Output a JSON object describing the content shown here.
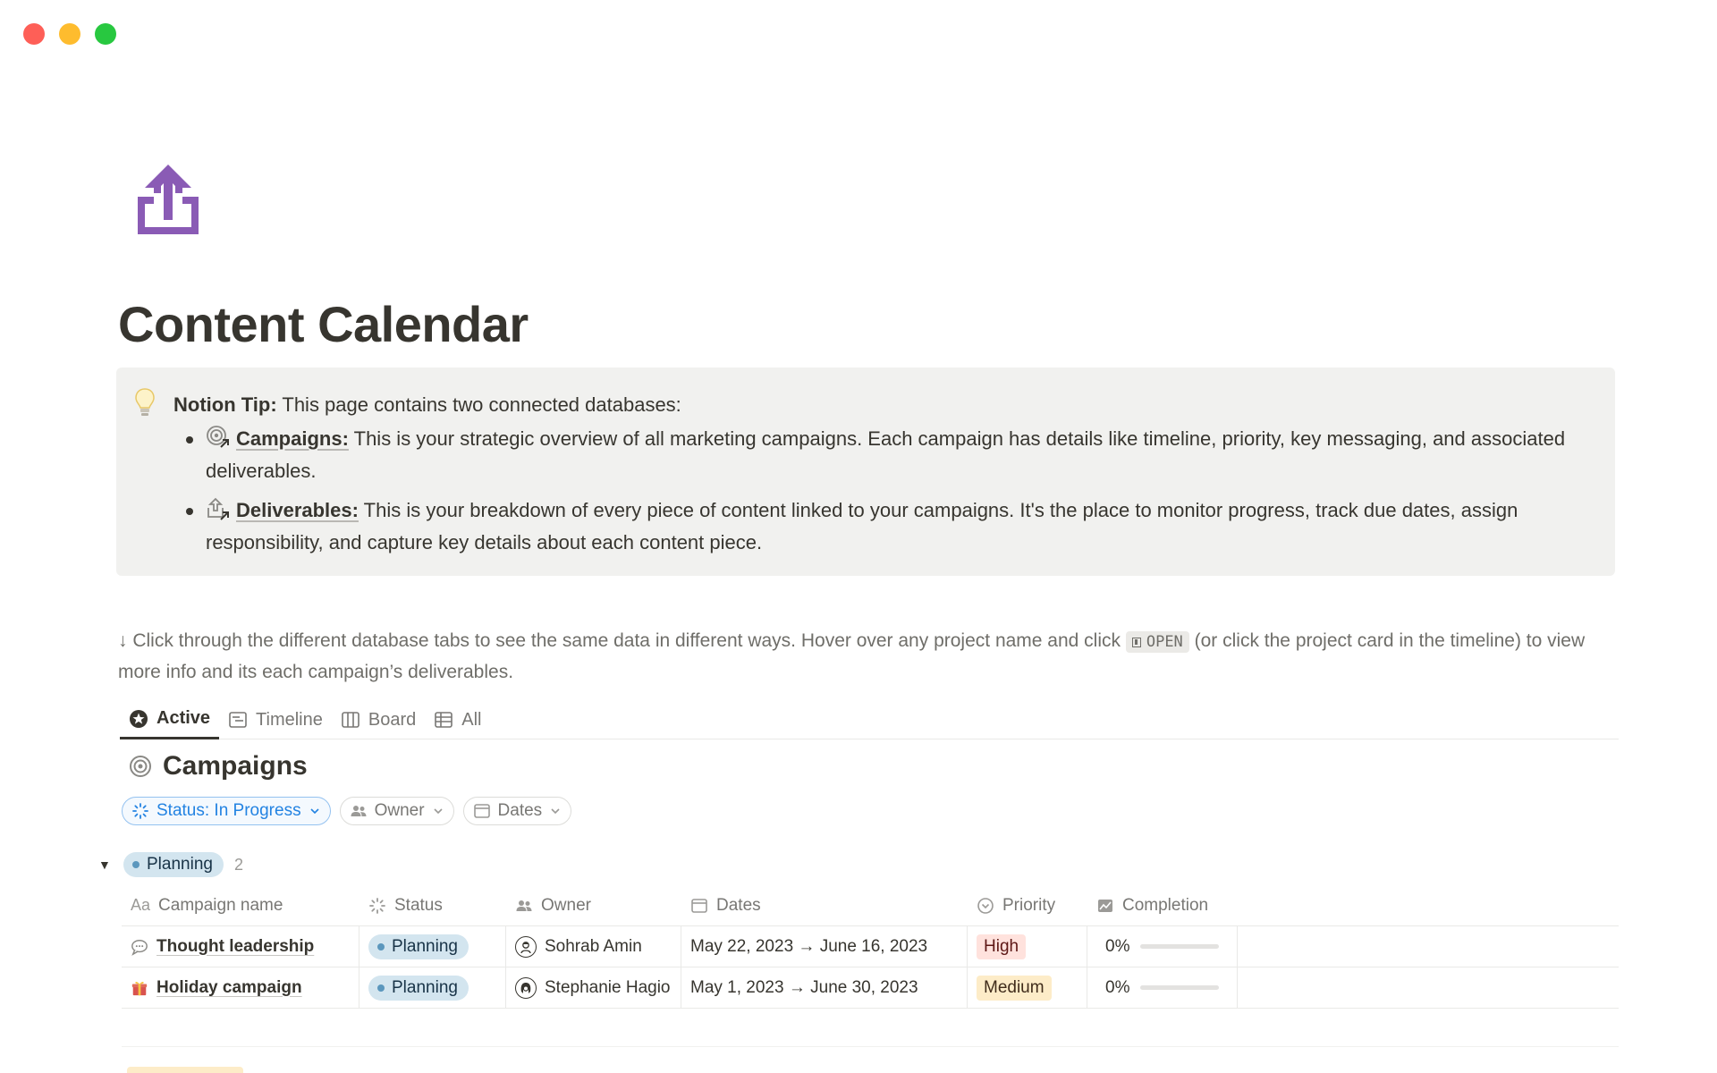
{
  "window": {
    "controls": [
      "close",
      "minimize",
      "zoom"
    ]
  },
  "page": {
    "icon": "share-upload-icon",
    "title": "Content Calendar"
  },
  "callout": {
    "icon": "lightbulb-icon",
    "tip_label": "Notion Tip:",
    "tip_text": " This page contains two connected databases:",
    "items": [
      {
        "icon": "target-link-icon",
        "title": "Campaigns:",
        "text": " This is your strategic overview of all marketing campaigns. Each campaign has details like timeline, priority, key messaging, and associated deliverables."
      },
      {
        "icon": "upload-link-icon",
        "title": "Deliverables:",
        "text": " This is your breakdown of every piece of content linked to your campaigns. It's the place to monitor progress, track due dates, assign responsibility, and capture key details about each content piece."
      }
    ]
  },
  "hint": {
    "before": "↓ Click through the different database tabs to see the same data in different ways. Hover over any project name and click ",
    "code": "OPEN",
    "after": " (or click the project card in the timeline) to view more info and its each campaign’s deliverables."
  },
  "tabs": [
    {
      "label": "Active",
      "icon": "star-badge-icon",
      "active": true
    },
    {
      "label": "Timeline",
      "icon": "timeline-icon",
      "active": false
    },
    {
      "label": "Board",
      "icon": "board-icon",
      "active": false
    },
    {
      "label": "All",
      "icon": "table-icon",
      "active": false
    }
  ],
  "database": {
    "title": "Campaigns",
    "icon": "target-icon",
    "filters": [
      {
        "label": "Status: In Progress",
        "icon": "loader-icon",
        "active": true
      },
      {
        "label": "Owner",
        "icon": "people-icon",
        "active": false
      },
      {
        "label": "Dates",
        "icon": "calendar-icon",
        "active": false
      }
    ],
    "group": {
      "label": "Planning",
      "count": "2"
    },
    "columns": [
      {
        "label": "Campaign name",
        "prefix": "Aa"
      },
      {
        "label": "Status",
        "icon": "loader-icon"
      },
      {
        "label": "Owner",
        "icon": "people-icon"
      },
      {
        "label": "Dates",
        "icon": "calendar-icon"
      },
      {
        "label": "Priority",
        "icon": "chevron-circle-icon"
      },
      {
        "label": "Completion",
        "icon": "chart-icon"
      }
    ],
    "rows": [
      {
        "icon": "speech-bubble-icon",
        "name": "Thought leadership",
        "status": "Planning",
        "owner": "Sohrab Amin",
        "dates": "May 22, 2023 → June 16, 2023",
        "priority": "High",
        "completion": "0%",
        "completion_value": 0
      },
      {
        "icon": "gift-icon",
        "name": "Holiday campaign",
        "status": "Planning",
        "owner": "Stephanie Hagio",
        "dates": "May 1, 2023 → June 30, 2023",
        "priority": "Medium",
        "completion": "0%",
        "completion_value": 0
      }
    ]
  },
  "colors": {
    "accent": "#2383e2",
    "icon_purple": "#8a5bb5",
    "status_blue": "#d3e5ef",
    "priority_high": "#ffe2dd",
    "priority_medium": "#fdecc8"
  }
}
